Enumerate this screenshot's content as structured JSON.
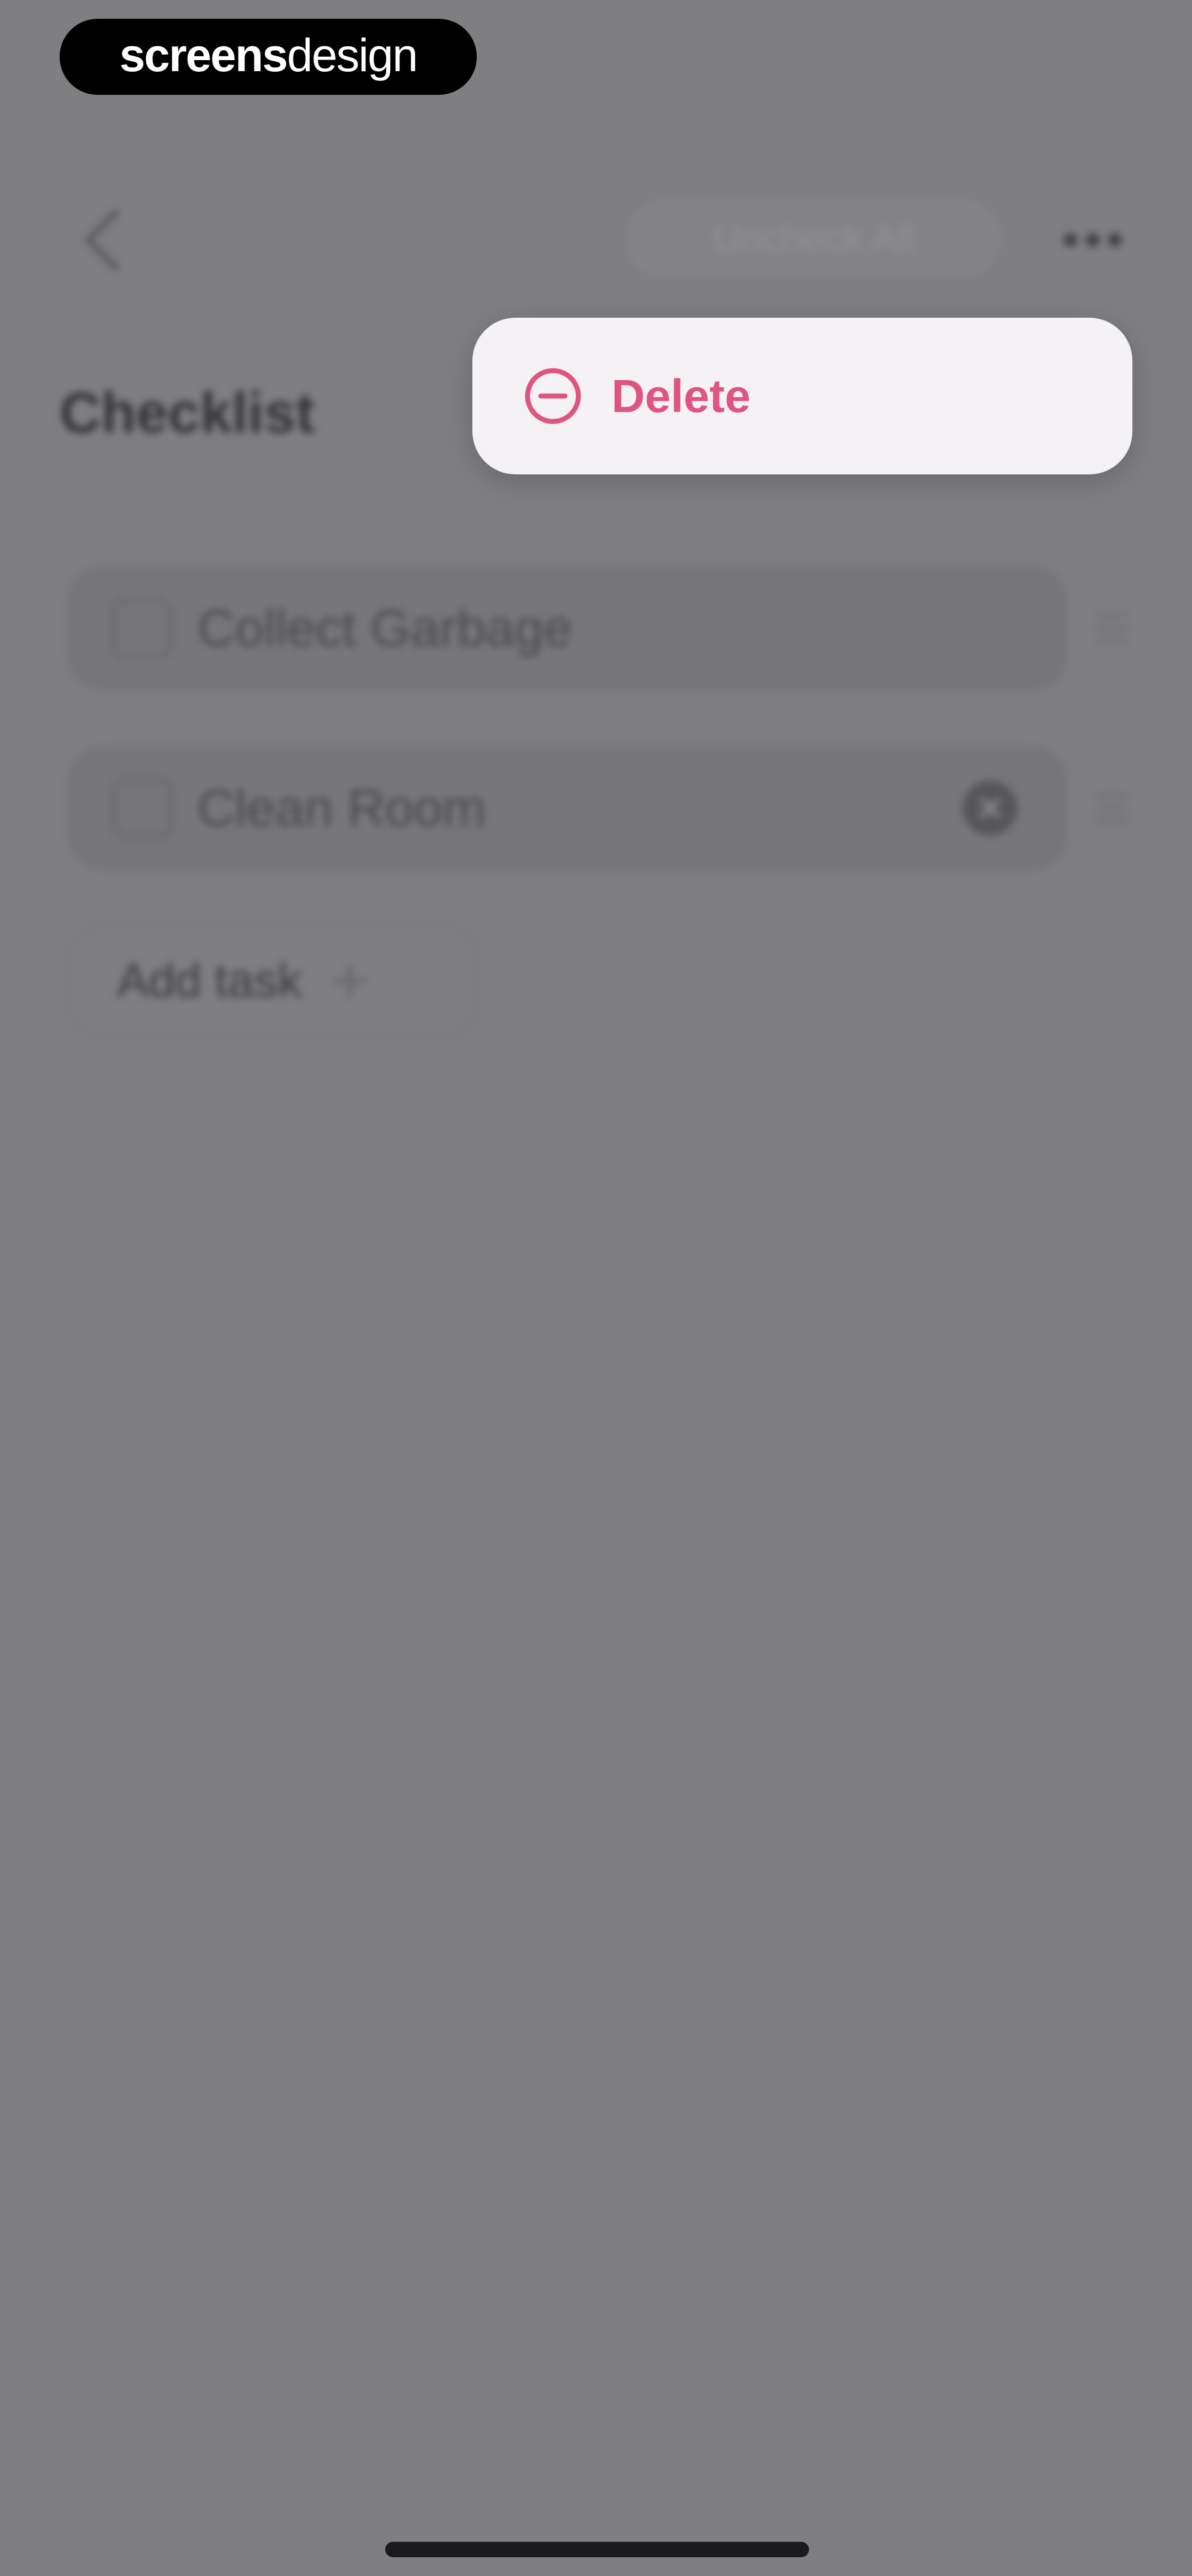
{
  "watermark": {
    "bold": "screens",
    "light": "design"
  },
  "header": {
    "uncheck_all_label": "Uncheck All"
  },
  "page": {
    "title": "Checklist"
  },
  "tasks": [
    {
      "label": "Collect Garbage",
      "checked": false
    },
    {
      "label": "Clean Room",
      "checked": false
    }
  ],
  "add_task": {
    "label": "Add task"
  },
  "context_menu": {
    "items": [
      {
        "label": "Delete",
        "icon": "minus-circle-icon"
      }
    ]
  },
  "colors": {
    "overlay_background": "#7f7e81",
    "menu_background": "#f4f2f4",
    "destructive": "#e0557f"
  }
}
